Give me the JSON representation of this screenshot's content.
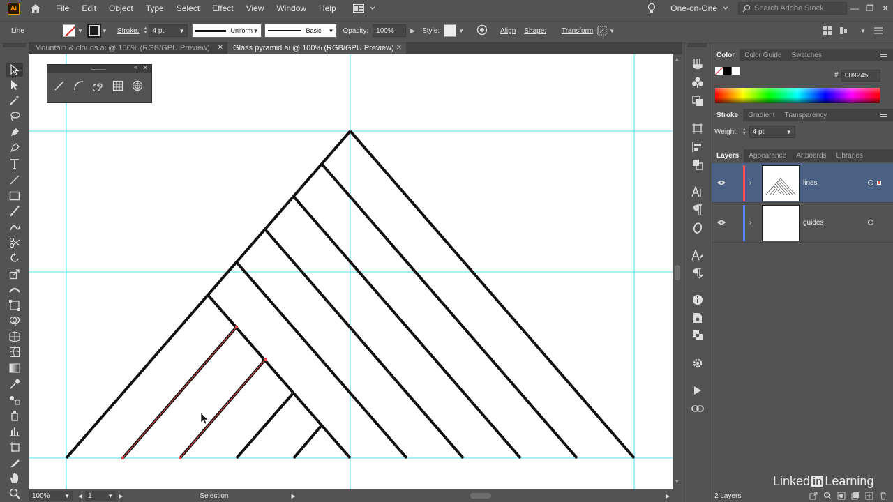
{
  "app": {
    "logo": "Ai"
  },
  "menu": [
    "File",
    "Edit",
    "Object",
    "Type",
    "Select",
    "Effect",
    "View",
    "Window",
    "Help"
  ],
  "workspace": "One-on-One",
  "stock_search_placeholder": "Search Adobe Stock",
  "control": {
    "object_type": "Line",
    "stroke_label": "Stroke:",
    "stroke_value": "4 pt",
    "profile_uniform": "Uniform",
    "brush_basic": "Basic",
    "opacity_label": "Opacity:",
    "opacity_value": "100%",
    "style_label": "Style:",
    "align": "Align",
    "shape": "Shape:",
    "transform": "Transform"
  },
  "tabs": [
    {
      "label": "Mountain & clouds.ai @ 100% (RGB/GPU Preview)",
      "active": false
    },
    {
      "label": "Glass pyramid.ai @ 100% (RGB/GPU Preview)",
      "active": true
    }
  ],
  "status": {
    "zoom": "100%",
    "artboard": "1",
    "tool": "Selection"
  },
  "color_panel": {
    "tabs": [
      "Color",
      "Color Guide",
      "Swatches"
    ],
    "hash": "#",
    "hex": "009245"
  },
  "stroke_panel": {
    "tabs": [
      "Stroke",
      "Gradient",
      "Transparency"
    ],
    "weight_label": "Weight:",
    "weight_value": "4 pt"
  },
  "layers_panel": {
    "tabs": [
      "Layers",
      "Appearance",
      "Artboards",
      "Libraries"
    ],
    "layers": [
      {
        "name": "lines",
        "color": "#ff4f4f",
        "selected": true
      },
      {
        "name": "guides",
        "color": "#4f7fff",
        "selected": false
      }
    ],
    "count": "2 Layers"
  },
  "watermark": {
    "pre": "Linked",
    "in": "in",
    "post": "Learning"
  },
  "colors": {
    "guide": "#4de1f0",
    "selection": "#e04848",
    "ui_bg": "#535353"
  }
}
